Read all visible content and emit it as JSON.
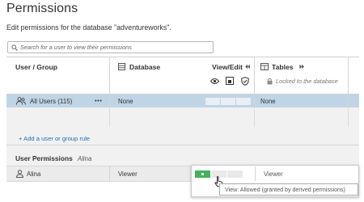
{
  "page": {
    "title": "Permissions",
    "subtitle": "Edit permissions for the database \"adventureworks\"."
  },
  "search": {
    "placeholder": "Search for a user to view their permissions"
  },
  "columns": {
    "user_group": "User / Group",
    "database": "Database",
    "view_edit": "View/Edit",
    "tables": "Tables",
    "tables_note": "Locked to the database"
  },
  "rule_row": {
    "name": "All Users (115)",
    "more": "•••",
    "database_value": "None",
    "tables_value": "None"
  },
  "add_rule_label": "+ Add a user or group rule",
  "user_permissions": {
    "label": "User Permissions",
    "user": "Alina",
    "row": {
      "name": "Alina",
      "database_value": "Viewer",
      "tables_value": "Viewer",
      "capability_state": "allowed"
    },
    "tooltip": "View: Allowed (granted by derived permissions)"
  },
  "colors": {
    "selected_row": "#bfd5e6",
    "allowed_green": "#43b35a",
    "link_blue": "#1f6fb5",
    "panel_gray": "#f1f1f1"
  },
  "icons": [
    "search-icon",
    "database-icon",
    "table-icon",
    "lock-icon",
    "view-eye-icon",
    "write-icon",
    "shield-icon",
    "group-icon",
    "user-icon",
    "cursor-pointer-icon",
    "double-arrow-icon"
  ]
}
